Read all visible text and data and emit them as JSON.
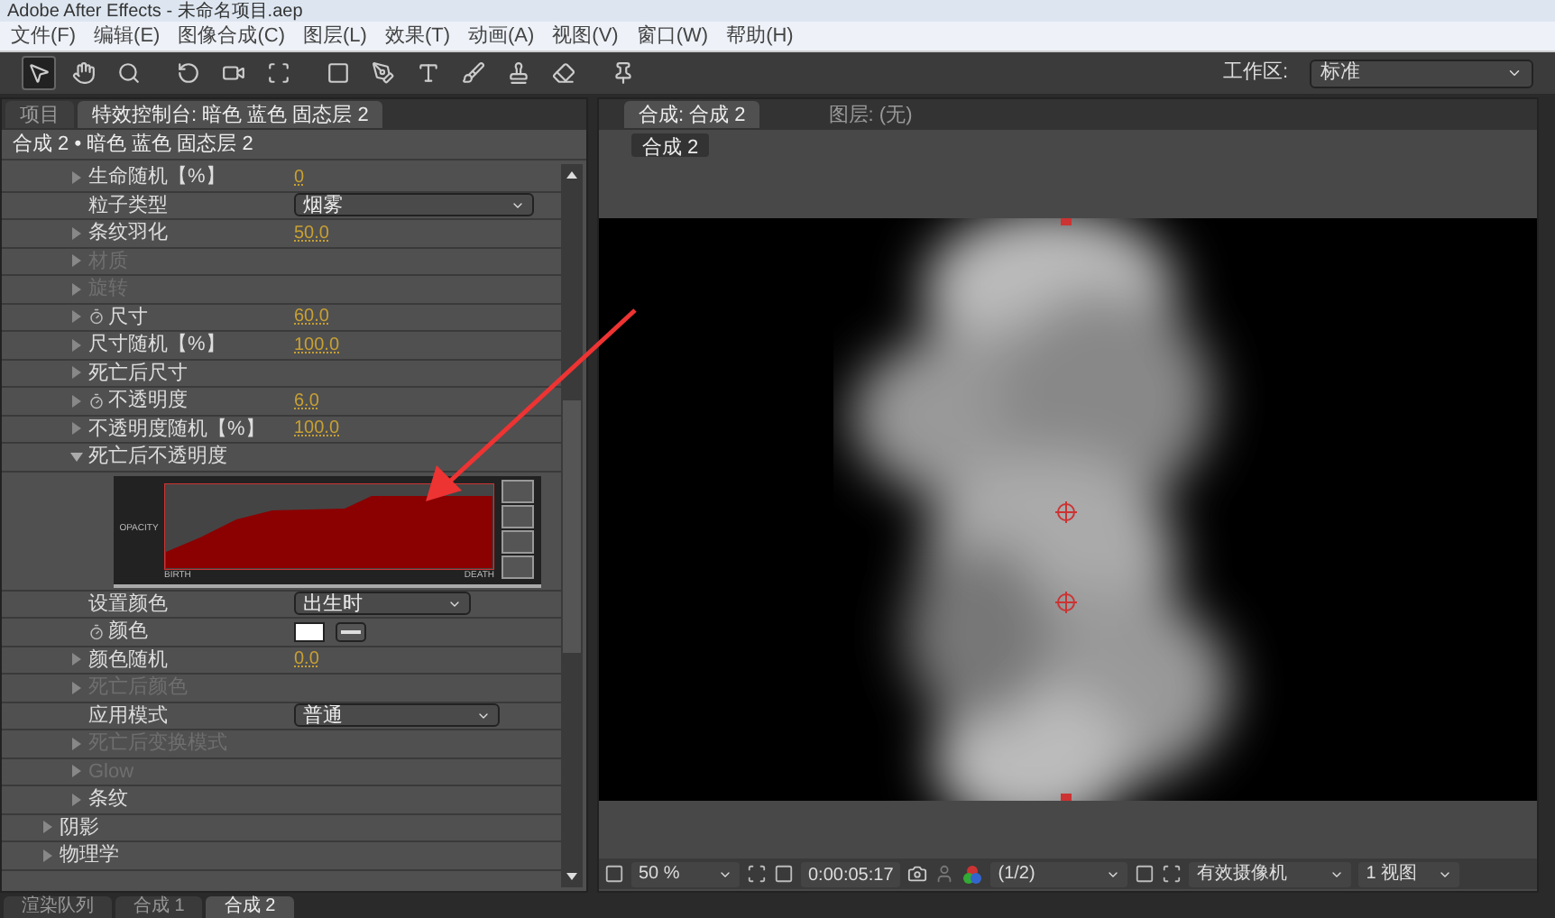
{
  "window": {
    "title": "Adobe After Effects - 未命名项目.aep"
  },
  "menu": [
    "文件(F)",
    "编辑(E)",
    "图像合成(C)",
    "图层(L)",
    "效果(T)",
    "动画(A)",
    "视图(V)",
    "窗口(W)",
    "帮助(H)"
  ],
  "toolbar": {
    "tools": [
      {
        "kind": "arrow",
        "selected": true
      },
      {
        "kind": "hand",
        "selected": false
      },
      {
        "kind": "zoom",
        "selected": false
      },
      {
        "kind": "rotate",
        "selected": false
      },
      {
        "kind": "camera",
        "selected": false
      },
      {
        "kind": "pan",
        "selected": false
      },
      {
        "kind": "rect",
        "selected": false
      },
      {
        "kind": "pen",
        "selected": false
      },
      {
        "kind": "text",
        "selected": false
      },
      {
        "kind": "brush",
        "selected": false
      },
      {
        "kind": "stamp",
        "selected": false
      },
      {
        "kind": "eraser",
        "selected": false
      },
      {
        "kind": "pin",
        "selected": false
      }
    ],
    "workspace_label": "工作区:",
    "workspace": "标准"
  },
  "left_panel": {
    "tabs": [
      {
        "label": "项目",
        "selected": false
      },
      {
        "label": "特效控制台: 暗色 蓝色 固态层 2",
        "selected": true
      }
    ],
    "header": "合成 2 • 暗色 蓝色 固态层 2",
    "rows": [
      {
        "kind": "value",
        "label": "生命随机【%】",
        "expanded": false,
        "value": "0"
      },
      {
        "kind": "dropdown",
        "label": "粒子类型",
        "value": "烟雾"
      },
      {
        "kind": "value",
        "label": "条纹羽化",
        "expanded": false,
        "value": "50.0"
      },
      {
        "kind": "value",
        "label": "材质",
        "expanded": false,
        "disabled": true
      },
      {
        "kind": "value",
        "label": "旋转",
        "expanded": false,
        "disabled": true
      },
      {
        "kind": "value",
        "label": "尺寸",
        "expanded": false,
        "stopwatch": true,
        "value": "60.0"
      },
      {
        "kind": "value",
        "label": "尺寸随机【%】",
        "expanded": false,
        "value": "100.0"
      },
      {
        "kind": "value",
        "label": "死亡后尺寸",
        "expanded": false
      },
      {
        "kind": "value",
        "label": "不透明度",
        "expanded": false,
        "stopwatch": true,
        "value": "6.0"
      },
      {
        "kind": "value",
        "label": "不透明度随机【%】",
        "expanded": false,
        "value": "100.0"
      },
      {
        "kind": "value",
        "label": "死亡后不透明度",
        "expanded": true
      },
      {
        "kind": "graph",
        "y_label": "OPACITY",
        "start_label": "BIRTH",
        "end_label": "DEATH"
      },
      {
        "kind": "dropdown",
        "label": "设置颜色",
        "value": "出生时"
      },
      {
        "kind": "color",
        "label": "颜色",
        "stopwatch": true,
        "color": "#ffffff"
      },
      {
        "kind": "value",
        "label": "颜色随机",
        "expanded": false,
        "value": "0.0"
      },
      {
        "kind": "value",
        "label": "死亡后颜色",
        "expanded": false,
        "disabled": true
      },
      {
        "kind": "dropdown",
        "label": "应用模式",
        "value": "普通"
      },
      {
        "kind": "value",
        "label": "死亡后变换模式",
        "expanded": false,
        "disabled": true
      },
      {
        "kind": "value",
        "label": "Glow",
        "expanded": false,
        "disabled": true
      },
      {
        "kind": "value",
        "label": "条纹",
        "expanded": false
      }
    ],
    "sections": [
      {
        "label": "阴影",
        "expanded": false
      },
      {
        "label": "物理学",
        "expanded": false
      }
    ]
  },
  "comp_panel": {
    "tabs": [
      {
        "label": "合成: 合成 2",
        "selected": true
      },
      {
        "label": "图层: (无)",
        "selected": false
      }
    ],
    "comp_button": "合成 2",
    "footer": {
      "zoom": "50 %",
      "timecode": "0:00:05:17",
      "resolution": "(1/2)",
      "camera": "有效摄像机",
      "views": "1 视图"
    }
  },
  "bottom_tabs": [
    {
      "label": "渲染队列",
      "selected": false
    },
    {
      "label": "合成 1",
      "selected": false
    },
    {
      "label": "合成 2",
      "selected": true
    }
  ]
}
